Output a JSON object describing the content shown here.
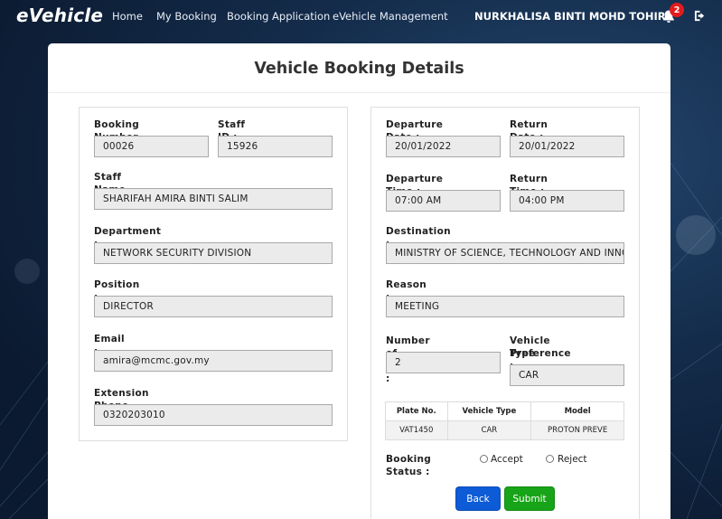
{
  "navbar": {
    "brand": "eVehicle",
    "links": [
      "Home",
      "My Booking",
      "Booking Application",
      "eVehicle Management"
    ],
    "user_name": "NURKHALISA BINTI MOHD TOHIR",
    "notification_count": "2"
  },
  "page": {
    "title": "Vehicle Booking Details"
  },
  "left": {
    "booking_number": {
      "label": "Booking Number :",
      "value": "00026"
    },
    "staff_id": {
      "label": "Staff ID :",
      "value": "15926"
    },
    "staff_name": {
      "label": "Staff Name :",
      "value": "SHARIFAH AMIRA BINTI SALIM"
    },
    "department": {
      "label": "Department :",
      "value": "NETWORK SECURITY DIVISION"
    },
    "position": {
      "label": "Position :",
      "value": "DIRECTOR"
    },
    "email": {
      "label": "Email :",
      "value": "amira@mcmc.gov.my"
    },
    "extension": {
      "label": "Extension Phone Number :",
      "value": "0320203010"
    }
  },
  "right": {
    "departure_date": {
      "label": "Departure Date :",
      "value": "20/01/2022"
    },
    "return_date": {
      "label": "Return Date :",
      "value": "20/01/2022"
    },
    "departure_time": {
      "label": "Departure Time :",
      "value": "07:00 AM"
    },
    "return_time": {
      "label": "Return Time :",
      "value": "04:00 PM"
    },
    "destination": {
      "label": "Destination :",
      "value": "MINISTRY OF SCIENCE, TECHNOLOGY AND INNOV"
    },
    "reason": {
      "label": "Reason :",
      "value": "MEETING"
    },
    "passengers": {
      "label": "Number of Passenger :",
      "value": "2"
    },
    "vehicle_pref": {
      "label_line1": "Vehicle Type",
      "label_line2": "Preference :",
      "value": "CAR"
    }
  },
  "vehicle_table": {
    "headers": [
      "Plate No.",
      "Vehicle Type",
      "Model"
    ],
    "rows": [
      [
        "VAT1450",
        "CAR",
        "PROTON PREVE"
      ]
    ]
  },
  "status": {
    "label": "Booking Status :",
    "options": [
      "Accept",
      "Reject"
    ]
  },
  "buttons": {
    "back": "Back",
    "submit": "Submit"
  }
}
